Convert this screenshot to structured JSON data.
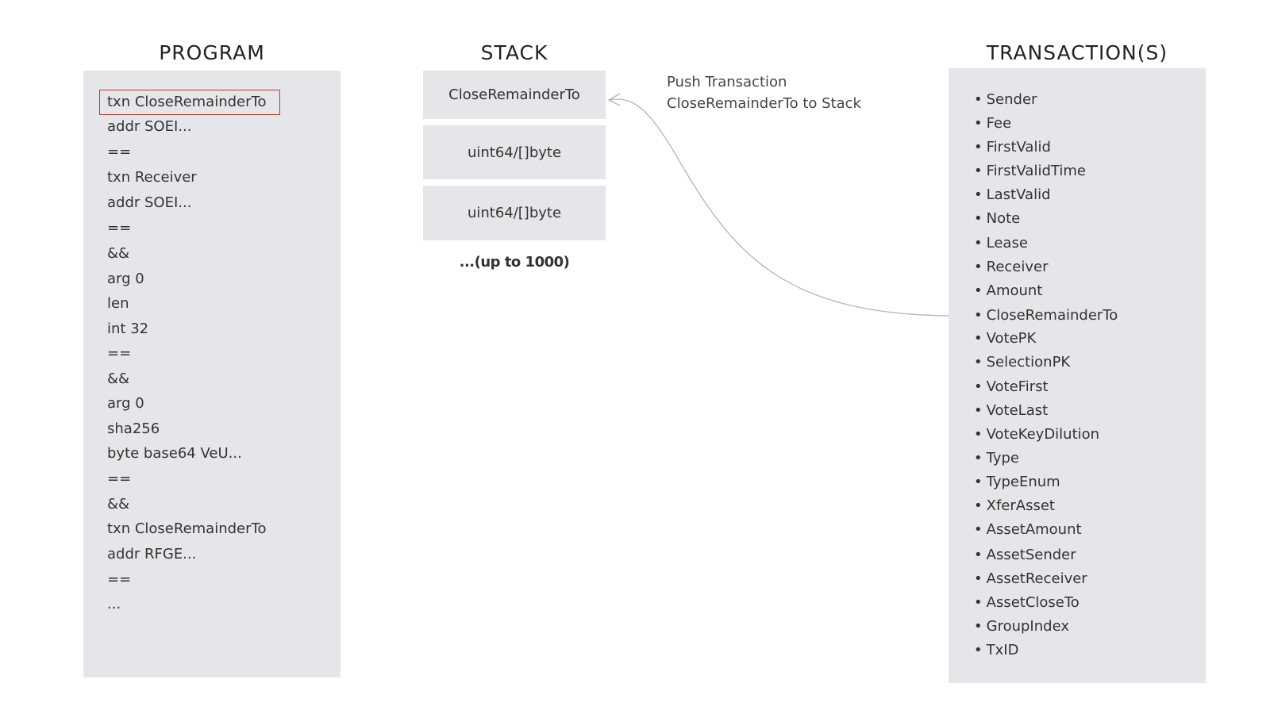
{
  "program": {
    "title": "PROGRAM",
    "lines": [
      "txn CloseRemainderTo",
      "addr SOEI...",
      "==",
      "txn Receiver",
      "addr SOEI...",
      "==",
      "&&",
      "arg 0",
      "len",
      "int 32",
      "==",
      "&&",
      "arg 0",
      "sha256",
      "byte base64 VeU...",
      "==",
      "&&",
      "txn CloseRemainderTo",
      "addr RFGE...",
      "==",
      "..."
    ]
  },
  "stack": {
    "title": "STACK",
    "items": [
      "CloseRemainderTo",
      "uint64/[]byte",
      "uint64/[]byte"
    ],
    "more": "...(up to 1000)"
  },
  "annotation": {
    "line1": "Push Transaction",
    "line2": "CloseRemainderTo to Stack"
  },
  "transactions": {
    "title": "TRANSACTION(S)",
    "bullet": "•",
    "fields": [
      "Sender",
      "Fee",
      "FirstValid",
      "FirstValidTime",
      "LastValid",
      "Note",
      "Lease",
      "Receiver",
      "Amount",
      "CloseRemainderTo",
      "VotePK",
      "SelectionPK",
      "VoteFirst",
      "VoteLast",
      "VoteKeyDilution",
      "Type",
      "TypeEnum",
      "XferAsset",
      "AssetAmount",
      "AssetSender",
      "AssetReceiver",
      "AssetCloseTo",
      "GroupIndex",
      "TxID"
    ]
  },
  "colors": {
    "panel": "#e5e6ea",
    "highlight": "#c0392b",
    "arrow": "#b5b5b5"
  }
}
